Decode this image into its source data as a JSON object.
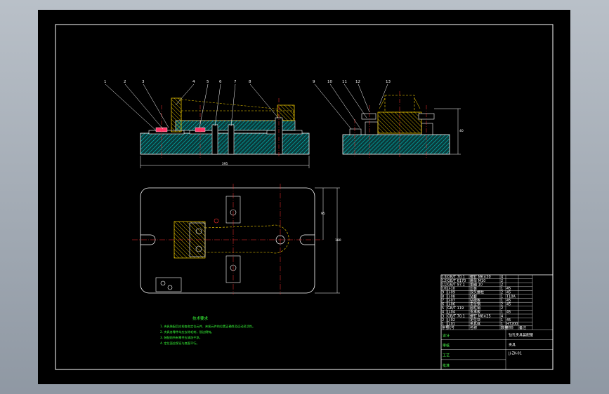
{
  "balloons": [
    "1",
    "2",
    "3",
    "4",
    "5",
    "6",
    "7",
    "8",
    "9",
    "10",
    "11",
    "12",
    "13"
  ],
  "dimensions": {
    "front_width": "395",
    "top_height": "95",
    "top_height2": "180",
    "side_height": "40"
  },
  "notes": {
    "title": "技术要求",
    "lines": [
      "1. 夹具装配后应检查各定位元件、夹紧元件的位置正确性及运动灵活性。",
      "2. 夹具各零件均应去除毛刺，锐边倒钝。",
      "3. 装配前所有零件应清洗干净。",
      "4. 定位面应保证与底面平行。"
    ]
  },
  "title_block": {
    "drawing_name": "钻孔夹具装配图",
    "unit": "夹具",
    "drawing_number": "JJ-ZK-01",
    "headers": [
      "序号",
      "代号",
      "名称",
      "数量",
      "材料",
      "备注"
    ],
    "rows": [
      [
        "13",
        "GB/T 70.1",
        "螺钉 M6×20",
        "4",
        "",
        ""
      ],
      [
        "12",
        "GB/T 6170",
        "螺母 M10",
        "2",
        "",
        ""
      ],
      [
        "11",
        "GB/T 97.1",
        "垫圈 10",
        "2",
        "",
        ""
      ],
      [
        "10",
        "JJ-10",
        "压板",
        "1",
        "45",
        ""
      ],
      [
        "9",
        "JJ-09",
        "双头螺柱",
        "2",
        "45",
        ""
      ],
      [
        "8",
        "JJ-08",
        "钻套",
        "1",
        "T10A",
        ""
      ],
      [
        "7",
        "JJ-07",
        "钻模板",
        "1",
        "45",
        ""
      ],
      [
        "6",
        "JJ-06",
        "定位销",
        "2",
        "45",
        ""
      ],
      [
        "5",
        "GB/T 119",
        "圆柱销",
        "2",
        "",
        ""
      ],
      [
        "4",
        "JJ-04",
        "支承板",
        "1",
        "45",
        ""
      ],
      [
        "3",
        "GB/T 70.1",
        "螺钉 M8×25",
        "4",
        "",
        ""
      ],
      [
        "2",
        "JJ-02",
        "定位块",
        "1",
        "45",
        ""
      ],
      [
        "1",
        "JJ-01",
        "夹具体",
        "1",
        "HT200",
        ""
      ]
    ],
    "footer": [
      "设计",
      "审核",
      "工艺",
      "批准"
    ]
  },
  "colors": {
    "background": "#000000",
    "outline": "#ffffff",
    "hatch": "#00c8c8",
    "center": "#ff3030",
    "yellow": "#ffd800",
    "green": "#39ff39"
  }
}
